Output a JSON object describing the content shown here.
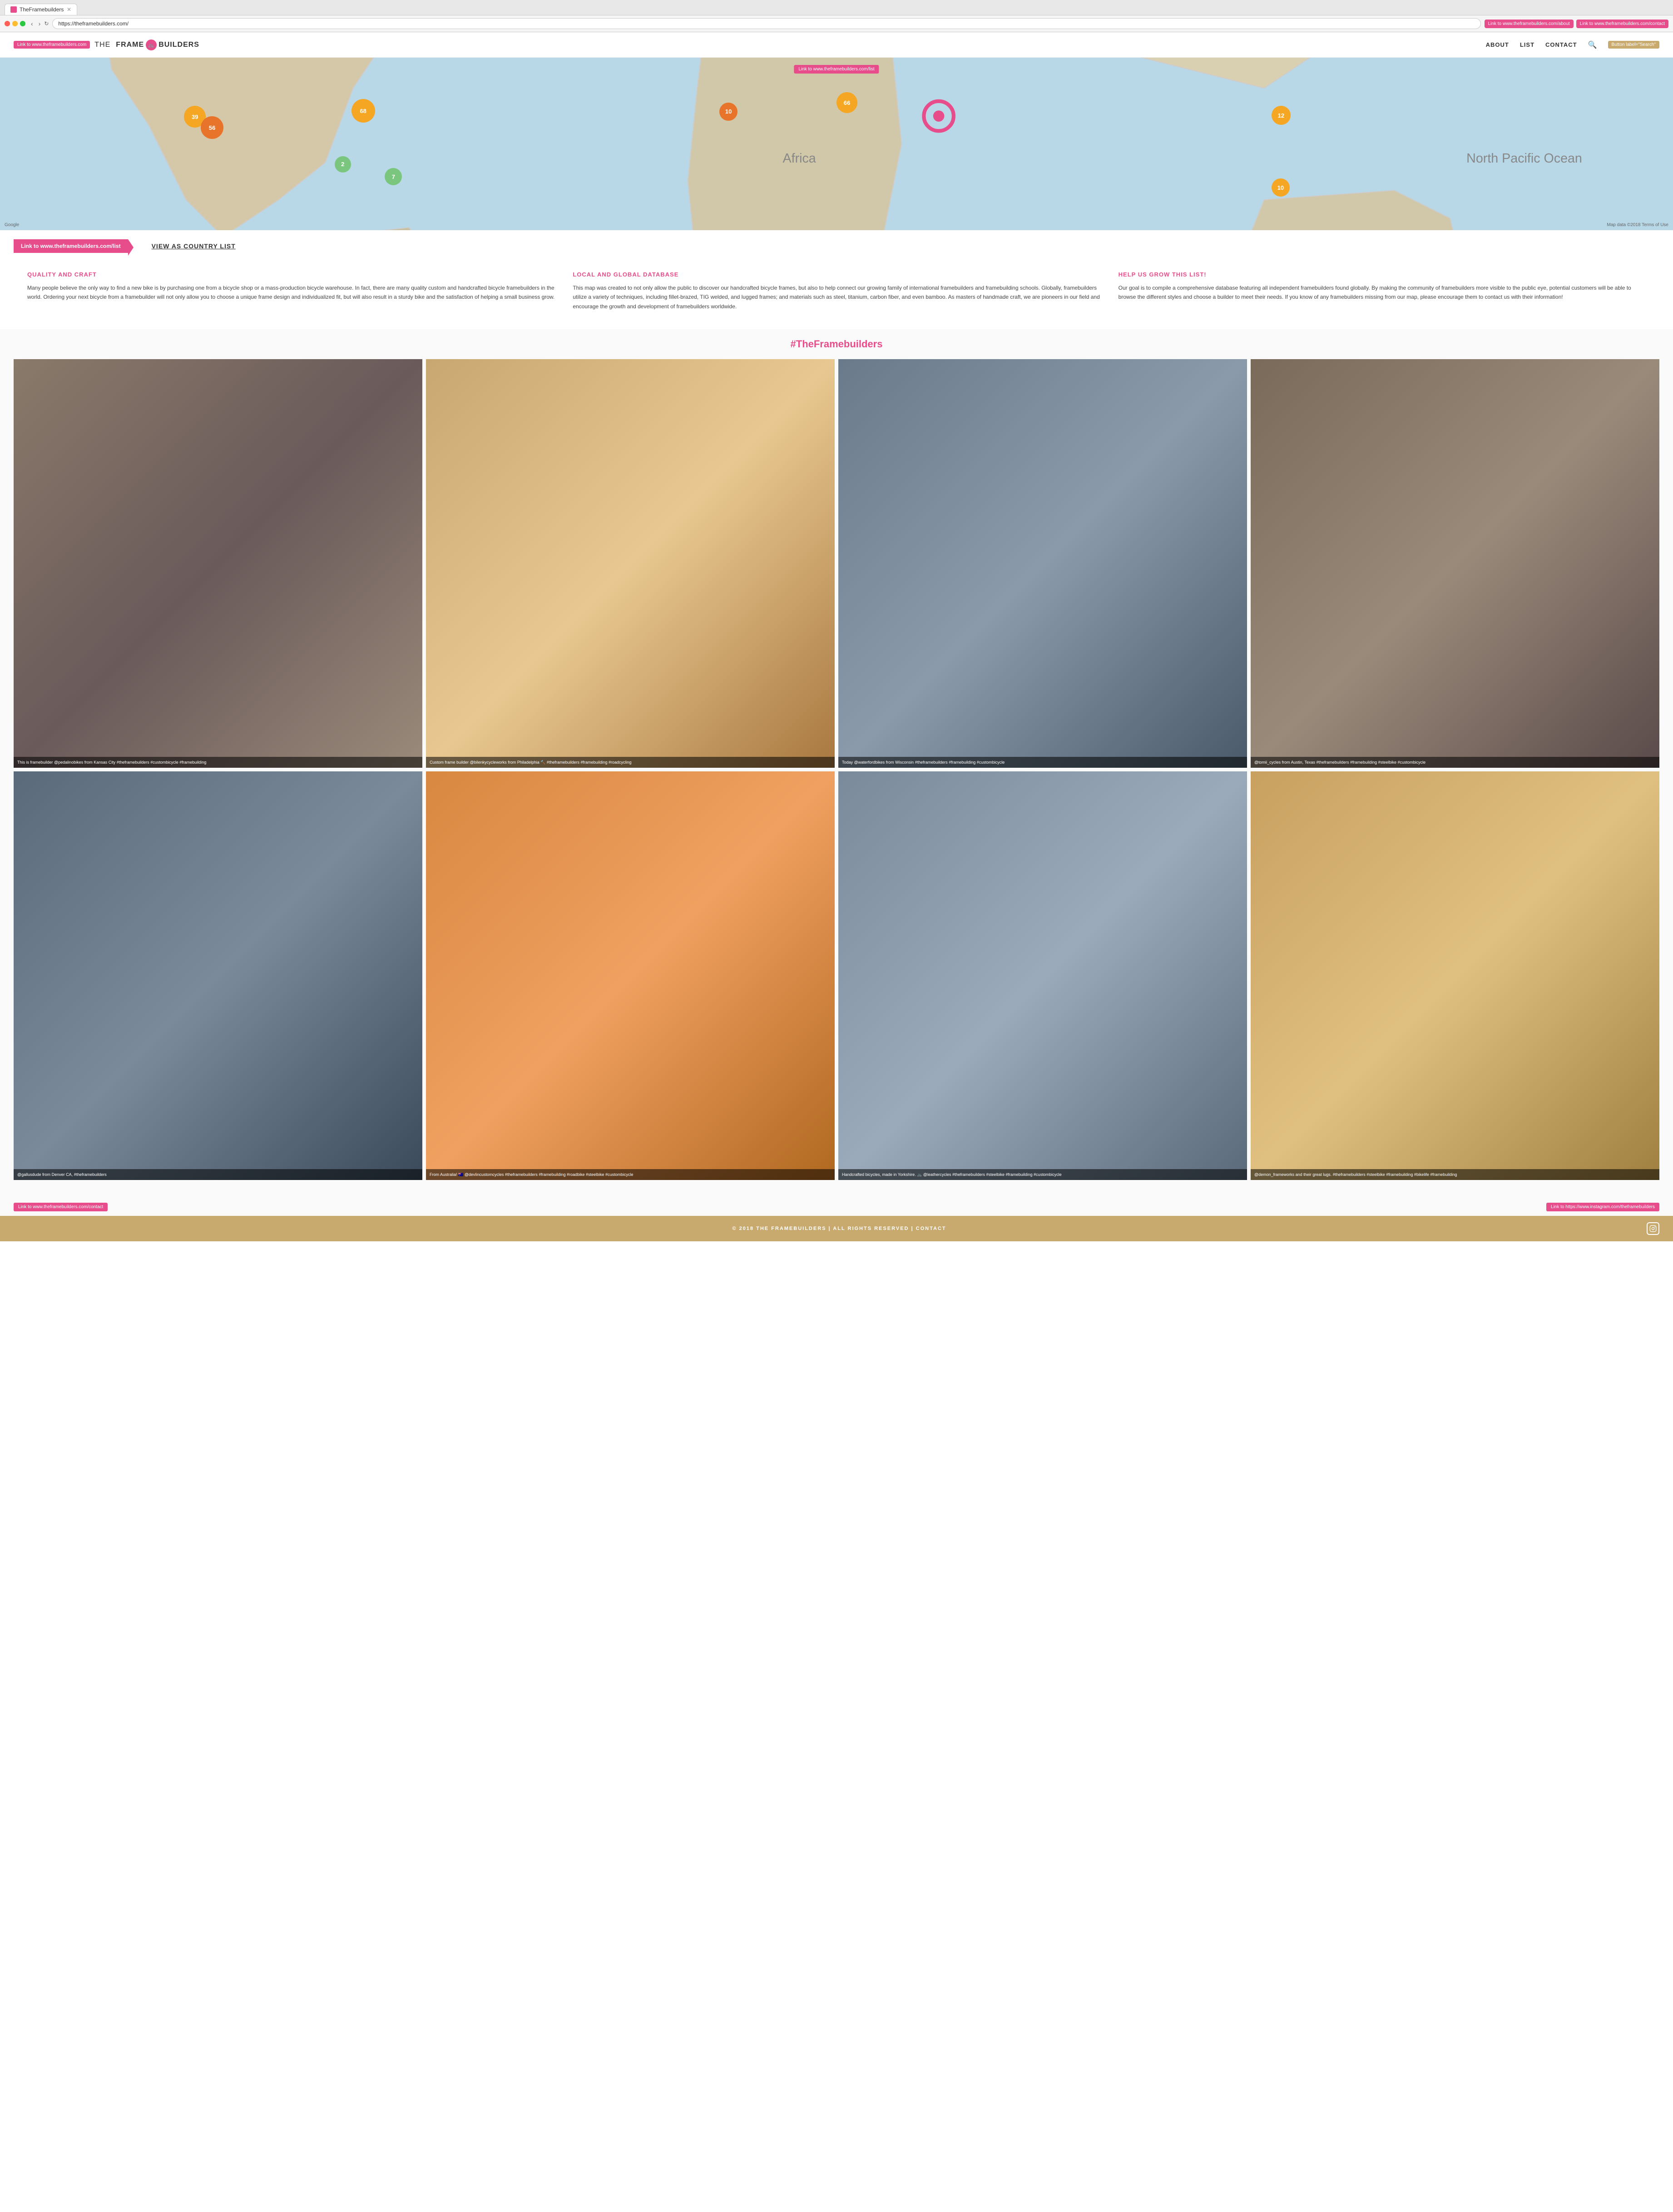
{
  "browser": {
    "tab_title": "TheFramebuilders",
    "address": "https://theframebuilders.com/",
    "ext_btn_about": "Link to www.theframebuilders.com/about",
    "ext_btn_contact": "Link to www.theframebuilders.com/contact"
  },
  "header": {
    "home_link_badge": "Link to www.theframebuilders.com",
    "logo_the": "THE",
    "logo_frame": "FRAME",
    "logo_builders": "BUILDERS",
    "nav": {
      "about": "ABOUT",
      "list": "LIST",
      "contact": "CONTACT"
    },
    "contact_badge": "Link to www.theframebuilders.com/contact",
    "search_badge": "Button label=\"Search\""
  },
  "map": {
    "list_badge": "Link to www.theframebuilders.com/list",
    "clusters": [
      {
        "id": "c1",
        "label": "39",
        "size": 48,
        "top": "28%",
        "left": "11%",
        "type": "orange"
      },
      {
        "id": "c2",
        "label": "68",
        "size": 52,
        "top": "26%",
        "left": "21%",
        "type": "orange"
      },
      {
        "id": "c3",
        "label": "56",
        "size": 50,
        "top": "34%",
        "left": "12%",
        "type": "dark-orange"
      },
      {
        "id": "c4",
        "label": "66",
        "size": 46,
        "top": "22%",
        "left": "51%",
        "type": "orange"
      },
      {
        "id": "c5",
        "label": "10",
        "size": 40,
        "top": "28%",
        "left": "43%",
        "type": "dark-orange"
      },
      {
        "id": "c6",
        "label": "2",
        "size": 36,
        "top": "58%",
        "left": "21%",
        "type": "green"
      },
      {
        "id": "c7",
        "label": "7",
        "size": 38,
        "top": "64%",
        "left": "23%",
        "type": "green"
      },
      {
        "id": "c8",
        "label": "12",
        "size": 42,
        "top": "30%",
        "left": "77%",
        "type": "orange"
      },
      {
        "id": "c9",
        "label": "10",
        "size": 40,
        "top": "72%",
        "left": "77%",
        "type": "orange"
      }
    ],
    "credit": "Google",
    "terms": "Map data ©2018  Terms of Use"
  },
  "view_list": {
    "badge_label": "Link to www.theframebuilders.com/list",
    "link_text": "VIEW AS COUNTRY LIST"
  },
  "info_sections": [
    {
      "title": "QUALITY AND CRAFT",
      "body": "Many people believe the only way to find a new bike is by purchasing one from a bicycle shop or a mass-production bicycle warehouse. In fact, there are many quality custom and handcrafted bicycle framebuilders in the world. Ordering your next bicycle from a framebuilder will not only allow you to choose a unique frame design and individualized fit, but will also result in a sturdy bike and the satisfaction of helping a small business grow."
    },
    {
      "title": "LOCAL AND GLOBAL DATABASE",
      "body": "This map was created to not only allow the public to discover our handcrafted bicycle frames, but also to help connect our growing family of international framebuilders and framebuilding schools. Globally, framebuilders utilize a variety of techniques, including fillet-brazed, TIG welded, and lugged frames; and materials such as steel, titanium, carbon fiber, and even bamboo. As masters of handmade craft, we are pioneers in our field and encourage the growth and development of framebuilders worldwide."
    },
    {
      "title": "HELP US GROW THIS LIST!",
      "body": "Our goal is to compile a comprehensive database featuring all independent framebuilders found globally. By making the community of framebuilders more visible to the public eye, potential customers will be able to browse the different styles and choose a builder to meet their needs. If you know of any framebuilders missing from our map, please encourage them to contact us with their information!"
    }
  ],
  "instagram": {
    "title": "#TheFramebuilders",
    "photos": [
      {
        "caption": "This is framebuilder @pedalinobikes from Kansas City #theframebuilders #custombicycle #framebuilding",
        "class": "ig-photo-1"
      },
      {
        "caption": "Custom frame builder @bilenkycycleworks from Philadelphia 🔨 #theframebuilders #framebuilding #roadcycling",
        "class": "ig-photo-2"
      },
      {
        "caption": "Today @waterfordbikes from Wisconsin #theframebuilders #framebuilding #custombicycle",
        "class": "ig-photo-3"
      },
      {
        "caption": "@tomii_cycles from Austin, Texas #theframebuilders #framebuilding #steelbike #custombicycle",
        "class": "ig-photo-4"
      },
      {
        "caption": "@gallusdude  from Denver CA, #theframebuilders",
        "class": "ig-photo-5"
      },
      {
        "caption": "From Australia! 🇦🇺 @devlincustomcycles #theframebuilders #framebuilding #roadbike #steelbike #custombicycle",
        "class": "ig-photo-6"
      },
      {
        "caption": "Handcrafted bicycles, made in Yorkshire. 🚲 @leathercycles #theframebuilders #steelbike #framebuilding #custombicycle",
        "class": "ig-photo-7"
      },
      {
        "caption": "@demon_frameworks and their great lugs. #theframebuilders #steelbike #framebuilding #bikelife #framebuilding",
        "class": "ig-photo-8"
      }
    ]
  },
  "footer_badges": {
    "left": "Link to www.theframebuilders.com/contact",
    "right": "Link to https://www.instagram.com/theframebuilders"
  },
  "footer": {
    "text": "© 2018 THE FRAMEBUILDERS   |   ALL RIGHTS RESERVED   |   CONTACT"
  }
}
